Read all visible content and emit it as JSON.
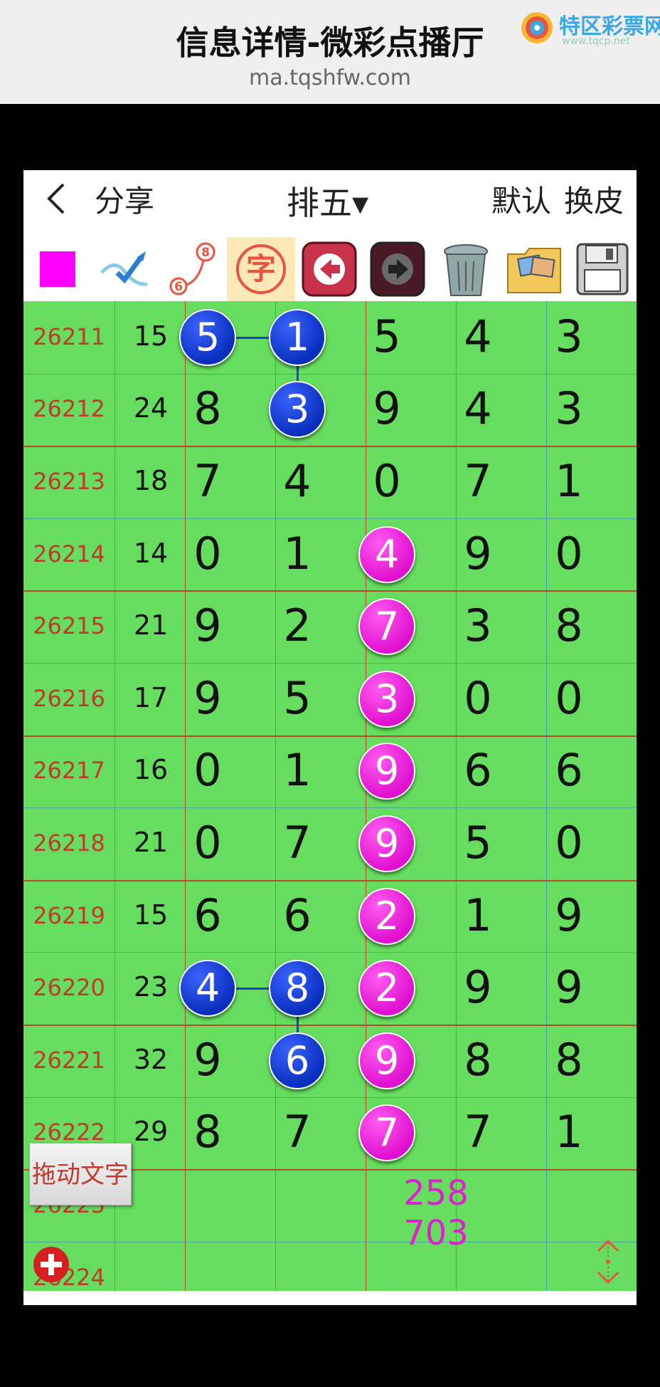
{
  "banner": {
    "title": "信息详情-微彩点播厅",
    "url": "ma.tqshfw.com",
    "brand_name": "特区彩票网",
    "brand_sub": "www.tqcp.net"
  },
  "appbar": {
    "back_icon": "chevron-left-icon",
    "share_label": "分享",
    "game_title": "排五▾",
    "default_label": "默认",
    "skin_label": "换皮"
  },
  "toolbar": {
    "color_swatch": "#ff00ff",
    "char_label": "字",
    "badge_top": "8",
    "badge_bottom": "6"
  },
  "rows": [
    {
      "issue": "26211",
      "sum": "15",
      "d": [
        "5",
        "1",
        "5",
        "4",
        "3"
      ]
    },
    {
      "issue": "26212",
      "sum": "24",
      "d": [
        "8",
        "3",
        "9",
        "4",
        "3"
      ]
    },
    {
      "issue": "26213",
      "sum": "18",
      "d": [
        "7",
        "4",
        "0",
        "7",
        "1"
      ]
    },
    {
      "issue": "26214",
      "sum": "14",
      "d": [
        "0",
        "1",
        "4",
        "9",
        "0"
      ]
    },
    {
      "issue": "26215",
      "sum": "21",
      "d": [
        "9",
        "2",
        "7",
        "3",
        "8"
      ]
    },
    {
      "issue": "26216",
      "sum": "17",
      "d": [
        "9",
        "5",
        "3",
        "0",
        "0"
      ]
    },
    {
      "issue": "26217",
      "sum": "16",
      "d": [
        "0",
        "1",
        "9",
        "6",
        "6"
      ]
    },
    {
      "issue": "26218",
      "sum": "21",
      "d": [
        "0",
        "7",
        "9",
        "5",
        "0"
      ]
    },
    {
      "issue": "26219",
      "sum": "15",
      "d": [
        "6",
        "6",
        "2",
        "1",
        "9"
      ]
    },
    {
      "issue": "26220",
      "sum": "23",
      "d": [
        "4",
        "8",
        "2",
        "9",
        "9"
      ]
    },
    {
      "issue": "26221",
      "sum": "32",
      "d": [
        "9",
        "6",
        "9",
        "8",
        "8"
      ]
    },
    {
      "issue": "26222",
      "sum": "29",
      "d": [
        "8",
        "7",
        "7",
        "7",
        "1"
      ]
    },
    {
      "issue": "26223",
      "sum": "",
      "d": [
        "",
        "",
        "",
        "",
        ""
      ]
    },
    {
      "issue": "26224",
      "sum": "",
      "d": [
        "",
        "",
        "",
        "",
        ""
      ]
    }
  ],
  "highlights": [
    {
      "row": 0,
      "col": 0,
      "color": "blue"
    },
    {
      "row": 0,
      "col": 1,
      "color": "blue"
    },
    {
      "row": 1,
      "col": 1,
      "color": "blue"
    },
    {
      "row": 3,
      "col": 2,
      "color": "pink"
    },
    {
      "row": 4,
      "col": 2,
      "color": "pink"
    },
    {
      "row": 5,
      "col": 2,
      "color": "pink"
    },
    {
      "row": 6,
      "col": 2,
      "color": "pink"
    },
    {
      "row": 7,
      "col": 2,
      "color": "pink"
    },
    {
      "row": 8,
      "col": 2,
      "color": "pink"
    },
    {
      "row": 9,
      "col": 0,
      "color": "blue"
    },
    {
      "row": 9,
      "col": 1,
      "color": "blue"
    },
    {
      "row": 9,
      "col": 2,
      "color": "pink"
    },
    {
      "row": 10,
      "col": 1,
      "color": "blue"
    },
    {
      "row": 10,
      "col": 2,
      "color": "pink"
    },
    {
      "row": 11,
      "col": 2,
      "color": "pink"
    }
  ],
  "prediction": {
    "line1": "258",
    "line2": "703"
  },
  "drag_text_label": "拖动文字",
  "colors": {
    "grid_bg": "#66dd5e",
    "issue_text": "#c0392b",
    "blue_ball": "#0a2fbd",
    "pink_ball": "#e010d0"
  }
}
